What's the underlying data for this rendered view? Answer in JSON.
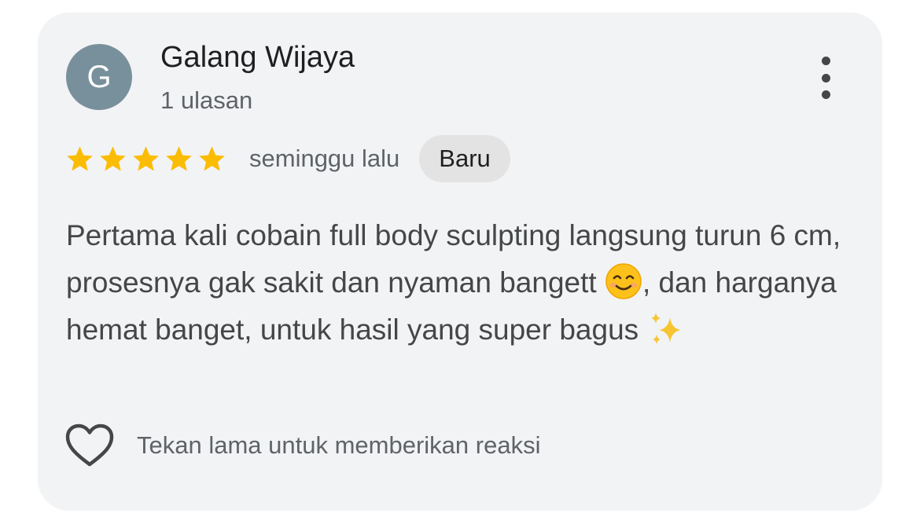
{
  "review": {
    "avatar_initial": "G",
    "reviewer_name": "Galang Wijaya",
    "review_count": "1 ulasan",
    "rating": 5,
    "rating_max": 5,
    "time_ago": "seminggu lalu",
    "badge": "Baru",
    "text_line_1": "Pertama kali cobain full body sculpting langsung turun 6 cm, prosesnya gak sakit dan nyaman bangett",
    "smile_emoji": "😊",
    "text_line_2": ", dan harganya hemat banget, untuk hasil yang super bagus",
    "sparkle_emoji": "✨",
    "reaction_hint": "Tekan lama untuk memberikan reaksi"
  },
  "icons": {
    "more": "more-vert-icon",
    "star": "star-icon",
    "heart": "heart-outline-icon",
    "smile": "smiling-face-emoji",
    "sparkle": "sparkles-emoji"
  },
  "colors": {
    "card_background": "#f2f3f5",
    "avatar_background": "#78909c",
    "star": "#fbbc04",
    "badge_background": "#e3e3e3"
  }
}
